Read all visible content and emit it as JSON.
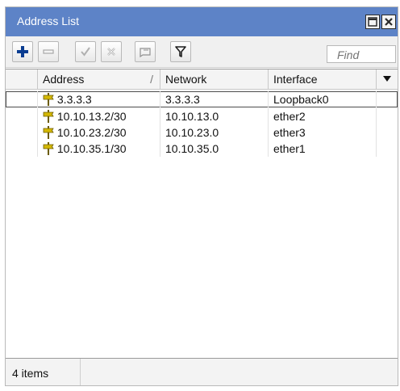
{
  "window": {
    "title": "Address List"
  },
  "toolbar": {
    "buttons": [
      "add",
      "remove",
      "enable",
      "disable",
      "comment",
      "filter"
    ],
    "find_placeholder": "Find"
  },
  "table": {
    "columns": [
      "Address",
      "Network",
      "Interface"
    ],
    "sort_indicator": "/",
    "rows": [
      {
        "address": "3.3.3.3",
        "network": "3.3.3.3",
        "interface": "Loopback0"
      },
      {
        "address": "10.10.13.2/30",
        "network": "10.10.13.0",
        "interface": "ether2"
      },
      {
        "address": "10.10.23.2/30",
        "network": "10.10.23.0",
        "interface": "ether3"
      },
      {
        "address": "10.10.35.1/30",
        "network": "10.10.35.0",
        "interface": "ether1"
      }
    ]
  },
  "status": {
    "count": "4 items"
  },
  "colors": {
    "titlebar": "#5d83c7",
    "add_icon": "#0b3d91",
    "address_icon": "#d4b800"
  },
  "icons": {
    "add": "plus-icon",
    "remove": "minus-icon",
    "enable": "check-icon",
    "disable": "x-icon",
    "comment": "note-icon",
    "filter": "funnel-icon",
    "maximize": "maximize-icon",
    "close": "close-icon",
    "address": "address-icon",
    "column_menu": "chevron-down-icon"
  }
}
